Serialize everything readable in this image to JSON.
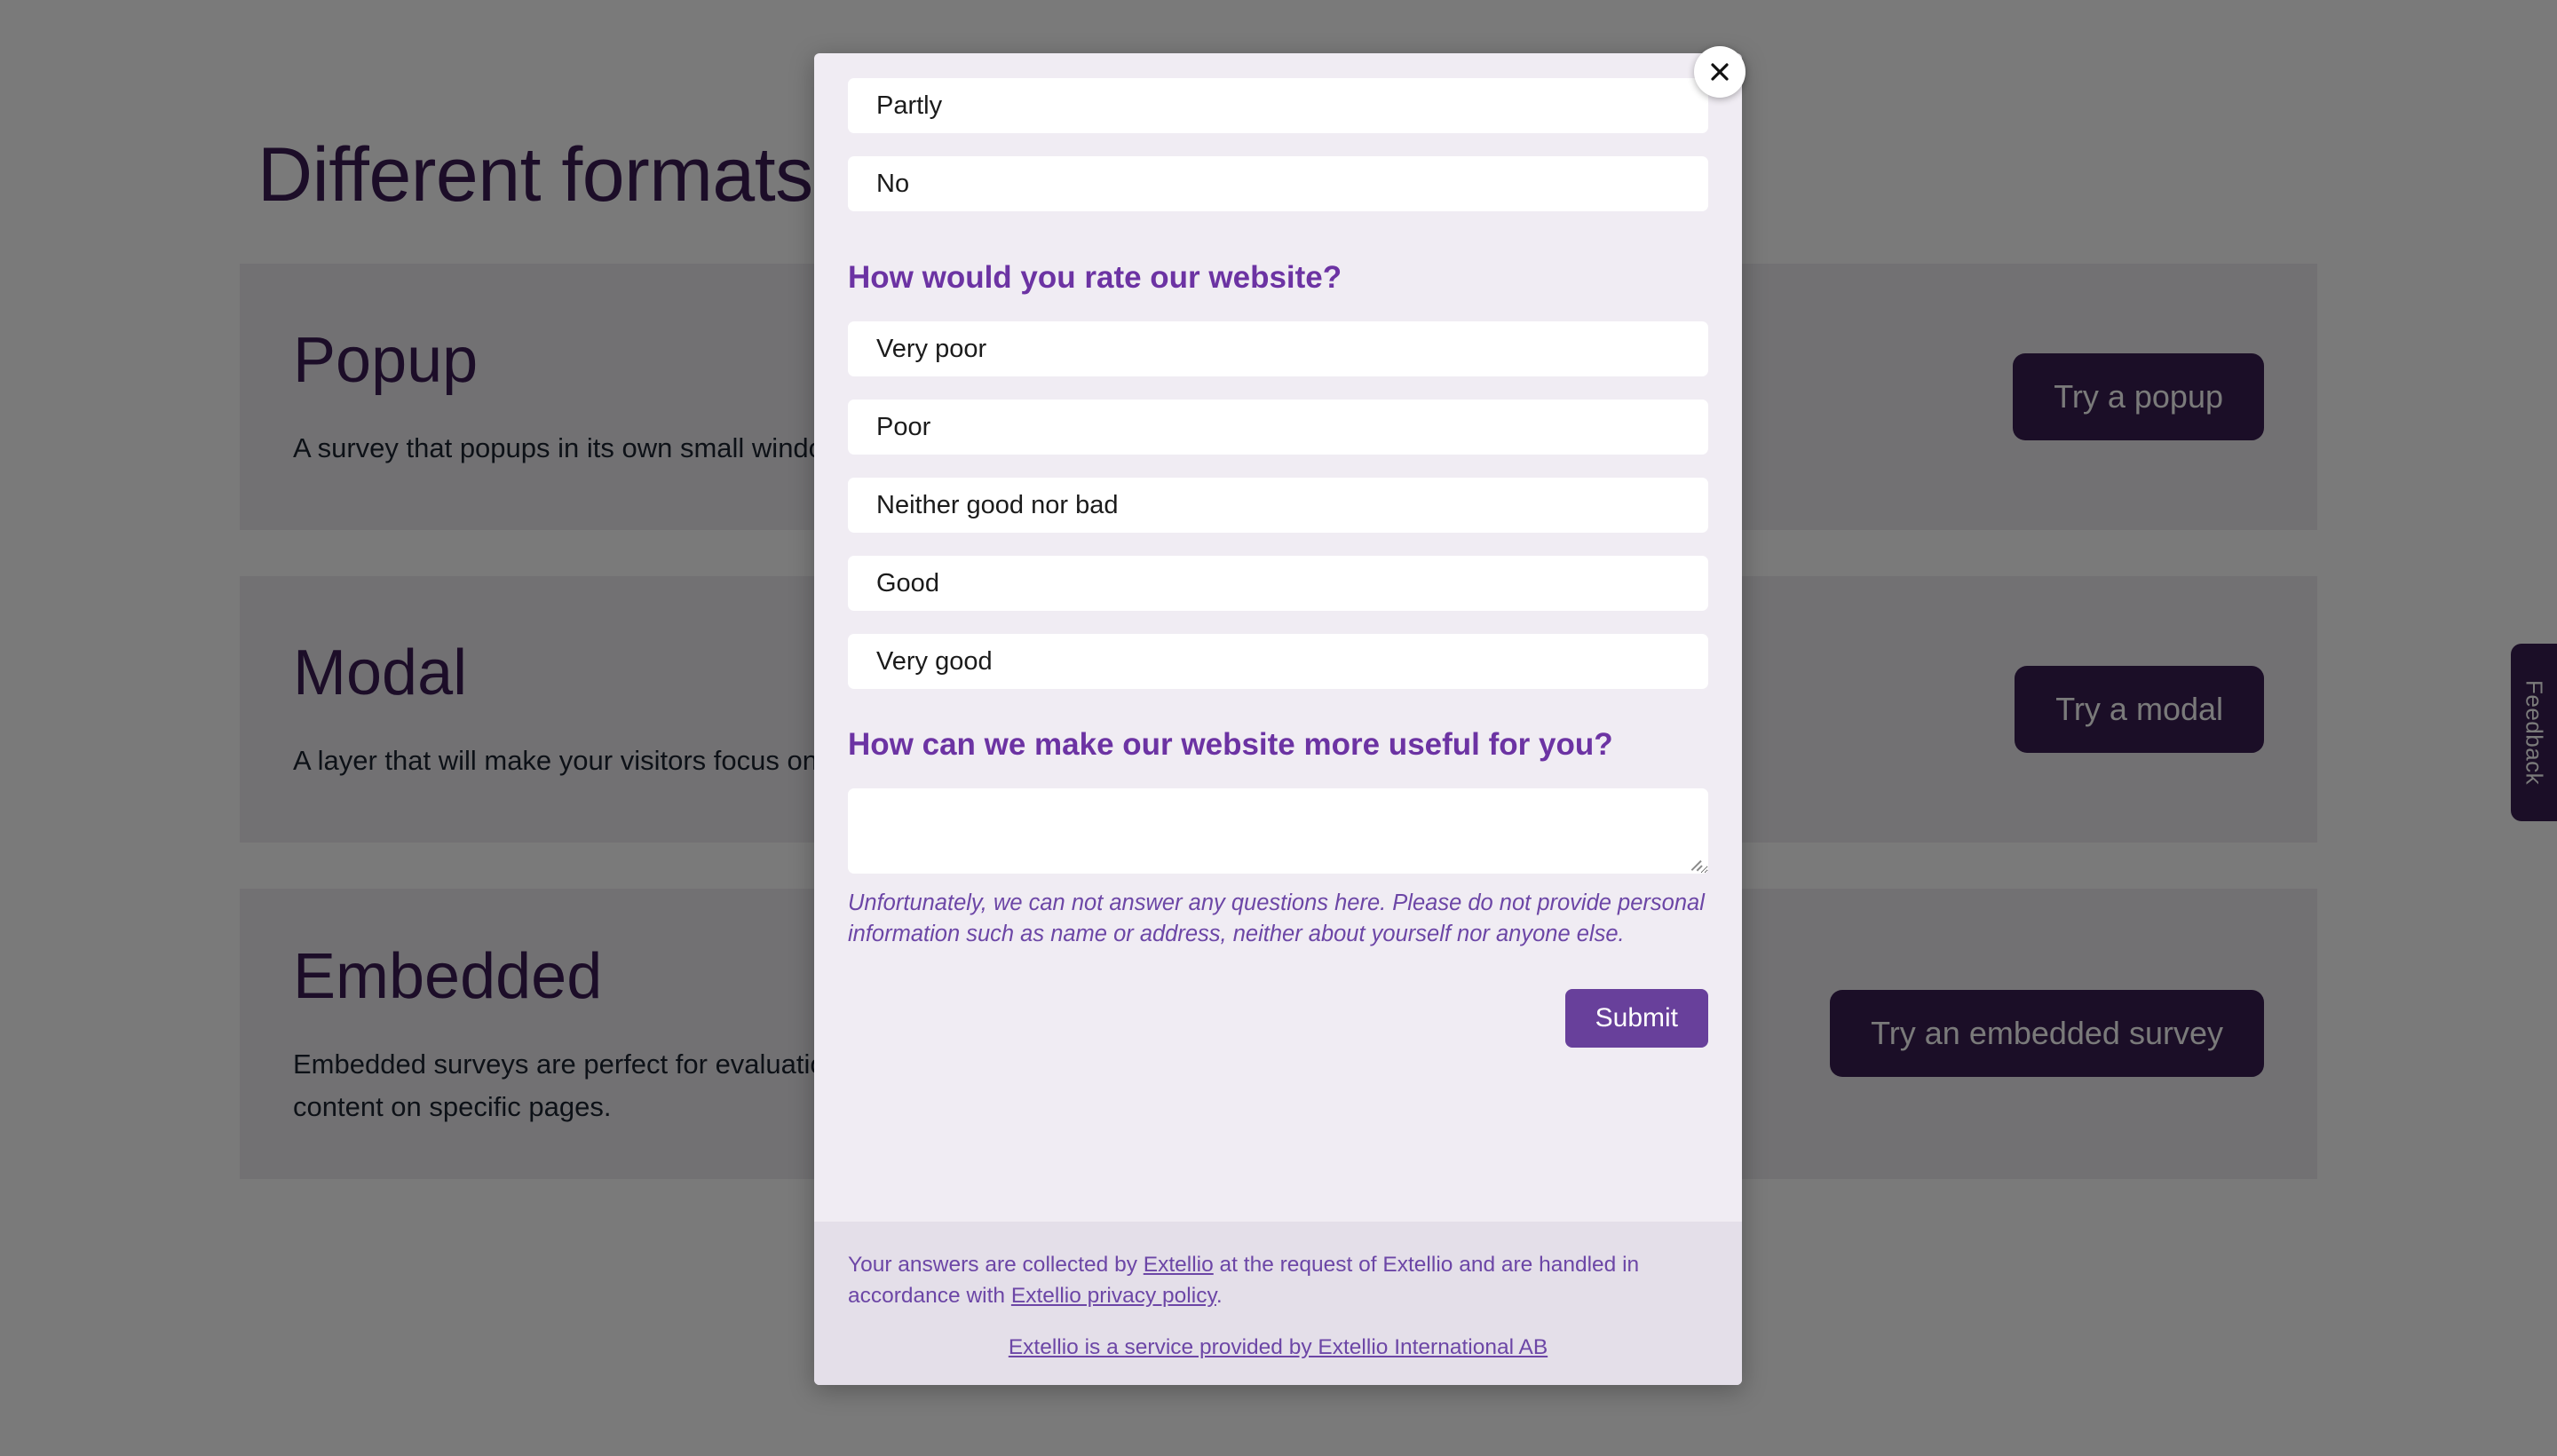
{
  "page": {
    "title": "Different formats",
    "cards": [
      {
        "title": "Popup",
        "desc": "A survey that popups in its own small window, on top of your own page.",
        "button": "Try a popup"
      },
      {
        "title": "Modal",
        "desc": "A layer that will make your visitors focus on the survey, and nothing else.",
        "button": "Try a modal"
      },
      {
        "title": "Embedded",
        "desc": "Embedded surveys are perfect for evaluations of processes (such as filling in forms, doing web training), or of content on specific pages.",
        "button": "Try an embedded survey"
      }
    ],
    "feedback_tab": "Feedback"
  },
  "modal": {
    "close_icon": "close-icon",
    "leftover_options": [
      "Partly",
      "No"
    ],
    "questions": [
      {
        "heading": "How would you rate our website?",
        "options": [
          "Very poor",
          "Poor",
          "Neither good nor bad",
          "Good",
          "Very good"
        ]
      },
      {
        "heading": "How can we make our website more useful for you?",
        "answer_value": "",
        "answer_placeholder": "",
        "disclaimer": "Unfortunately, we can not answer any questions here. Please do not provide personal information such as name or address, neither about yourself nor anyone else."
      }
    ],
    "submit_label": "Submit",
    "footer": {
      "legal_part1": "Your answers are collected by ",
      "legal_link1": "Extellio",
      "legal_part2": " at the request of Extellio and are handled in accordance with ",
      "legal_link2": "Extellio privacy policy",
      "legal_part3": ".",
      "provider_link": "Extellio is a service provided by Extellio International AB"
    }
  },
  "colors": {
    "brand_dark_purple": "#3a1f52",
    "brand_purple": "#6c33a3",
    "submit_purple": "#68409b",
    "modal_bg": "#f0ecf3",
    "footer_bg": "#e4dfe9",
    "card_bg": "#eeedf0"
  }
}
